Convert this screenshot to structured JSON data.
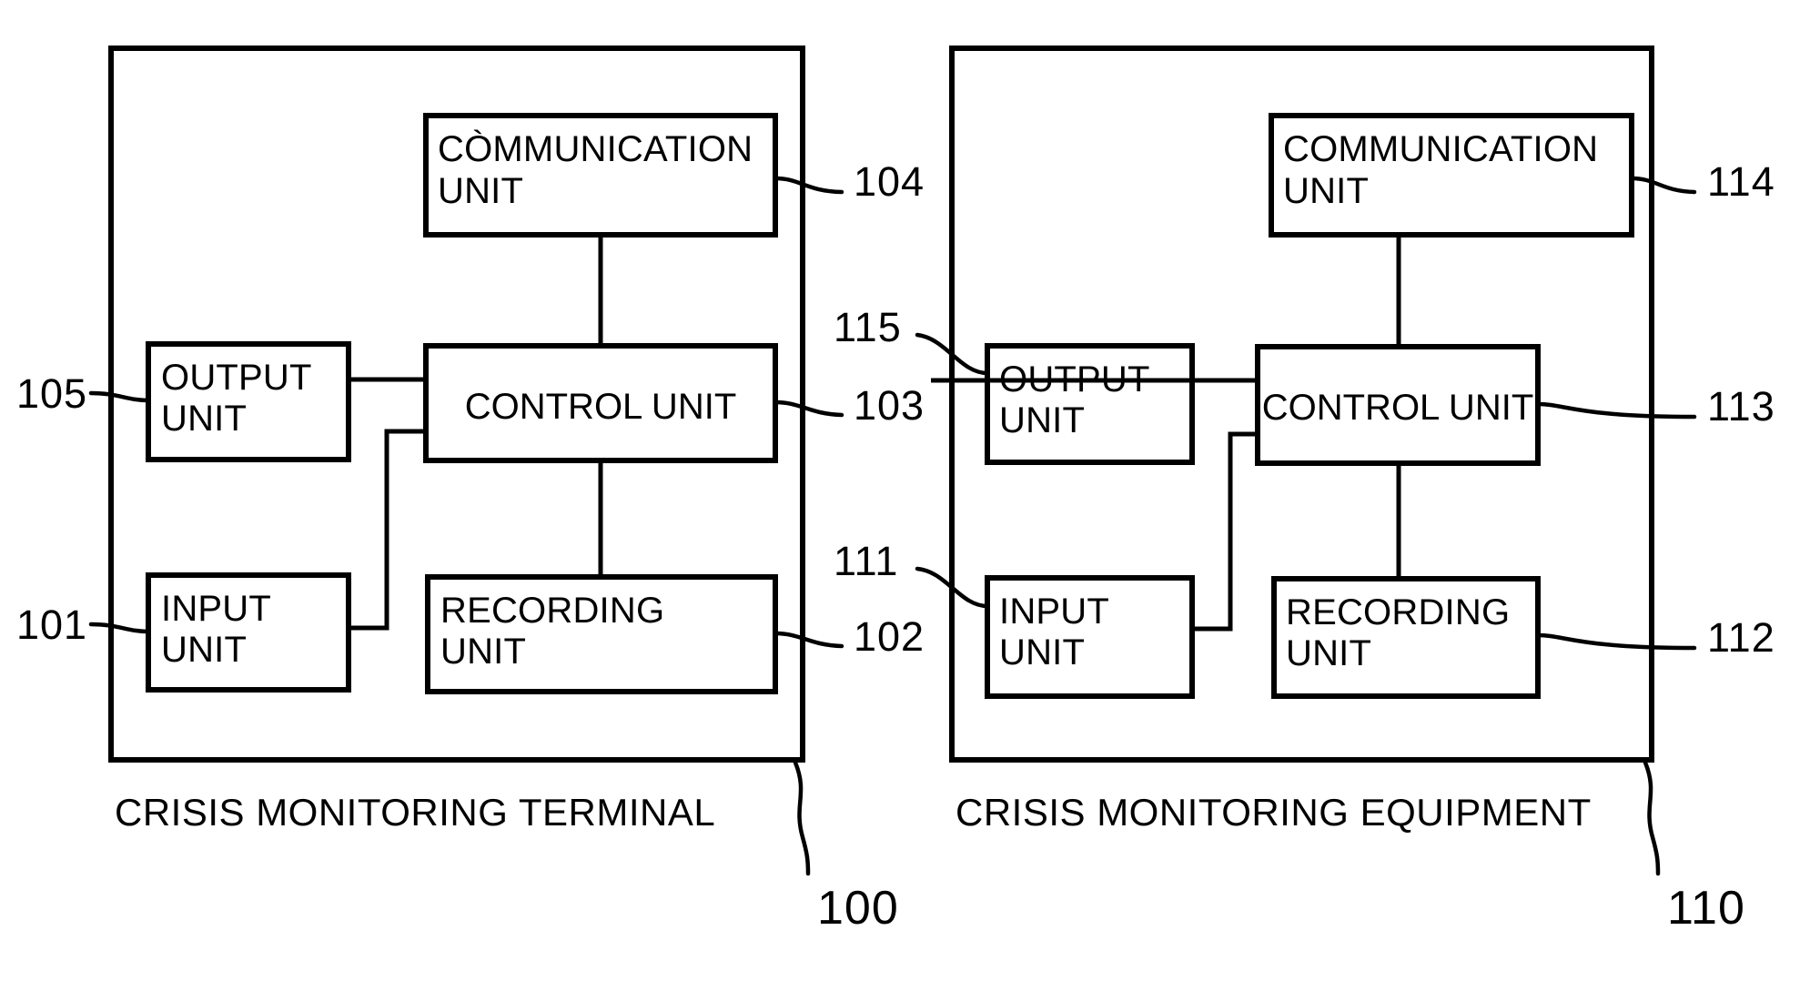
{
  "figure": {
    "type": "patent-block-diagram",
    "background_color": "#ffffff",
    "line_color": "#000000"
  },
  "left_system": {
    "caption": "CRISIS MONITORING TERMINAL",
    "ref": "100",
    "blocks": [
      {
        "id": "communication",
        "line1": "CÒMMUNICATION",
        "line2": "UNIT",
        "ref": "104"
      },
      {
        "id": "control",
        "line1": "CONTROL UNIT",
        "line2": "",
        "ref": "103"
      },
      {
        "id": "output",
        "line1": "OUTPUT",
        "line2": "UNIT",
        "ref": "105"
      },
      {
        "id": "input",
        "line1": "INPUT",
        "line2": "UNIT",
        "ref": "101"
      },
      {
        "id": "recording",
        "line1": "RECORDING",
        "line2": "UNIT",
        "ref": "102"
      }
    ]
  },
  "right_system": {
    "caption": "CRISIS MONITORING EQUIPMENT",
    "ref": "110",
    "blocks": [
      {
        "id": "communication",
        "line1": "COMMUNICATION",
        "line2": "UNIT",
        "ref": "114"
      },
      {
        "id": "control",
        "line1": "CONTROL UNIT",
        "line2": "",
        "ref": "113"
      },
      {
        "id": "output",
        "line1": "OUTPUT",
        "line2": "UNIT",
        "ref": "115"
      },
      {
        "id": "input",
        "line1": "INPUT",
        "line2": "UNIT",
        "ref": "111"
      },
      {
        "id": "recording",
        "line1": "RECORDING",
        "line2": "UNIT",
        "ref": "112"
      }
    ]
  }
}
